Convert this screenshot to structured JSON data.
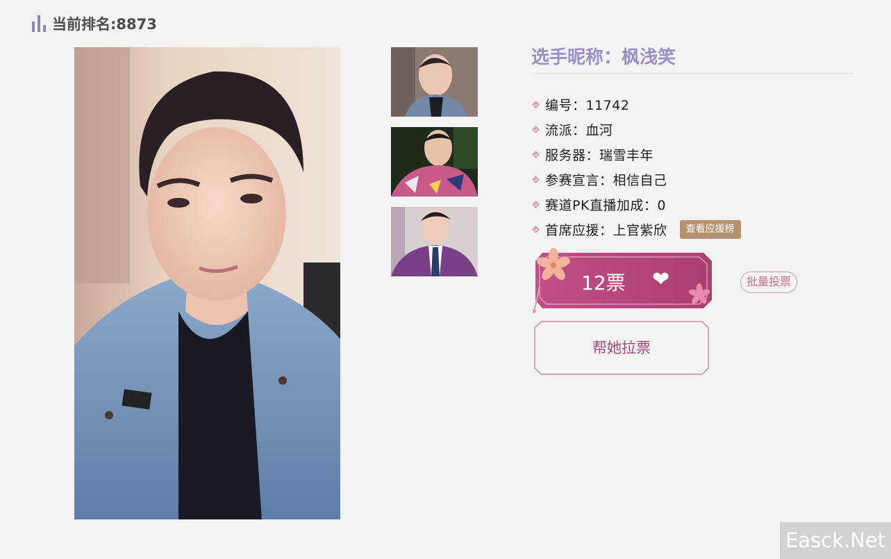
{
  "rank": {
    "label": "当前排名:8873",
    "icon": "bar-chart-icon"
  },
  "player": {
    "nickname": "选手昵称：枫浅笑",
    "info": [
      {
        "label": "编号：11742"
      },
      {
        "label": "流派：血河"
      },
      {
        "label": "服务器：瑞雪丰年"
      },
      {
        "label": "参赛宣言：相信自己"
      },
      {
        "label": "赛道PK直播加成：0"
      },
      {
        "label": "首席应援：上官紫欣"
      }
    ],
    "support_board_label": "查看应援榜"
  },
  "vote": {
    "count_label": "12票",
    "heart_icon": "heart-icon",
    "batch_label": "批量投票",
    "canvass_label": "帮她拉票"
  },
  "watermark": "Easck.Net",
  "colors": {
    "accent_purple": "#9a8fc6",
    "vote_pink": "#b8487c",
    "support_gold": "#b49270",
    "bullet_red": "#c8606c"
  }
}
